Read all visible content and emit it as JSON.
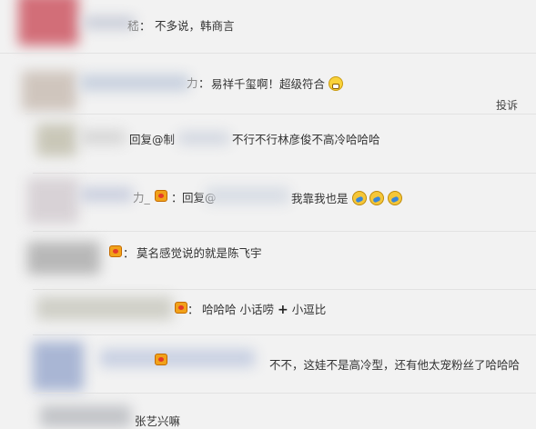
{
  "report_label": "投诉",
  "comments": [
    {
      "name_visible": "嵇",
      "text": "不多说，韩商言"
    },
    {
      "name_visible": "力",
      "text": "易祥千玺啊！超级符合"
    },
    {
      "prefix": "回复@制",
      "text": "不行不行林彦俊不高冷哈哈哈"
    },
    {
      "name_visible": "力_",
      "prefix": "回复@",
      "text": "我靠我也是"
    },
    {
      "text": "莫名感觉说的就是陈飞宇"
    },
    {
      "text": "哈哈哈 小话唠",
      "text_after": "小逗比"
    },
    {
      "text": "不不，这娃不是高冷型，还有他太宠粉丝了哈哈哈"
    },
    {
      "text": "张艺兴嘛"
    }
  ],
  "icons": [
    "crown-icon",
    "grin-emoji-icon",
    "laugh-cry-emoji-icon"
  ]
}
